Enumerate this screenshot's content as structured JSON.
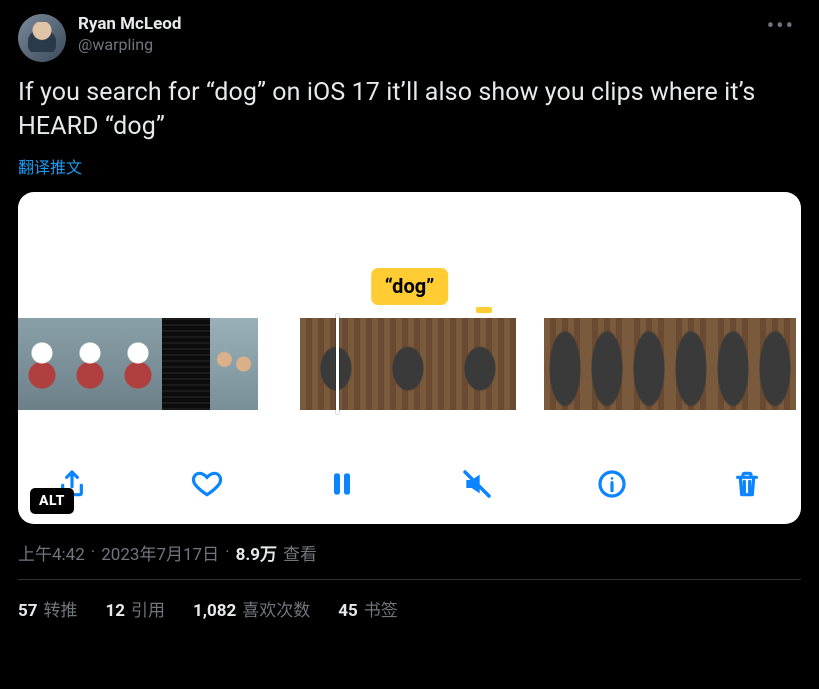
{
  "author": {
    "display_name": "Ryan McLeod",
    "handle": "@warpling"
  },
  "tweet_text": "If you search for “dog” on iOS 17 it’ll also show you clips where it’s HEARD “dog”",
  "translate_label": "翻译推文",
  "media": {
    "caption_tag": "“dog”",
    "alt_badge": "ALT",
    "toolbar": {
      "share": "share",
      "like": "like",
      "pause": "pause",
      "mute": "mute",
      "info": "info",
      "delete": "delete"
    }
  },
  "meta": {
    "time": "上午4:42",
    "sep1": " · ",
    "date": "2023年7月17日",
    "sep2": " · ",
    "views_count": "8.9万",
    "views_label": " 查看"
  },
  "stats": {
    "retweets": {
      "n": "57",
      "label": "转推"
    },
    "quotes": {
      "n": "12",
      "label": "引用"
    },
    "likes": {
      "n": "1,082",
      "label": "喜欢次数"
    },
    "bookmarks": {
      "n": "45",
      "label": "书签"
    }
  }
}
